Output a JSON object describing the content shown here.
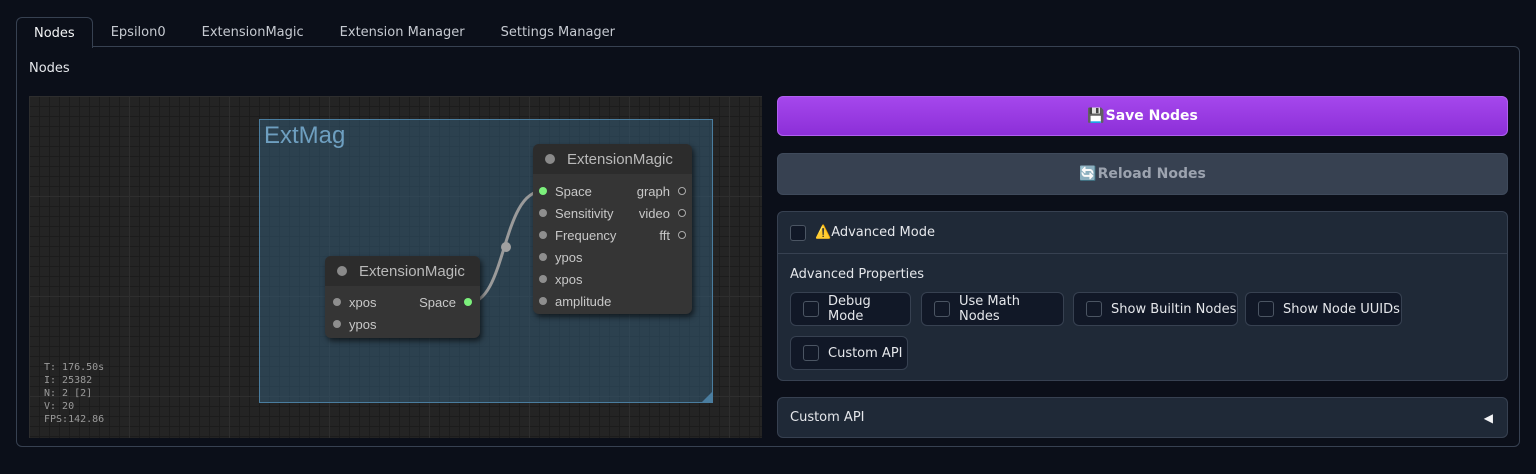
{
  "tabs": [
    {
      "label": "Nodes",
      "active": true
    },
    {
      "label": "Epsilon0"
    },
    {
      "label": "ExtensionMagic"
    },
    {
      "label": "Extension Manager"
    },
    {
      "label": "Settings Manager"
    }
  ],
  "panel_label": "Nodes",
  "graph": {
    "group_title": "ExtMag",
    "node_left": {
      "title": "ExtensionMagic",
      "inputs": [
        "xpos",
        "ypos"
      ],
      "outputs": [
        "Space"
      ]
    },
    "node_right": {
      "title": "ExtensionMagic",
      "inputs": [
        "Space",
        "Sensitivity",
        "Frequency",
        "ypos",
        "xpos",
        "amplitude"
      ],
      "outputs": [
        "graph",
        "video",
        "fft"
      ]
    },
    "stats": [
      "T: 176.50s",
      "I: 25382",
      "N: 2 [2]",
      "V: 20",
      "FPS:142.86"
    ]
  },
  "buttons": {
    "save_icon": "💾",
    "save_label": "Save Nodes",
    "reload_icon": "🔄",
    "reload_label": "Reload Nodes"
  },
  "advanced": {
    "mode_icon": "⚠️",
    "mode_label": "Advanced Mode",
    "properties_label": "Advanced Properties",
    "options": [
      "Debug Mode",
      "Use Math Nodes",
      "Show Builtin Nodes",
      "Show Node UUIDs",
      "Custom API"
    ]
  },
  "custom_api": {
    "label": "Custom API",
    "arrow": "◀"
  },
  "colors": {
    "accent": "#a547ec",
    "connected_pin": "#7cf07c",
    "group": "#335a73"
  }
}
